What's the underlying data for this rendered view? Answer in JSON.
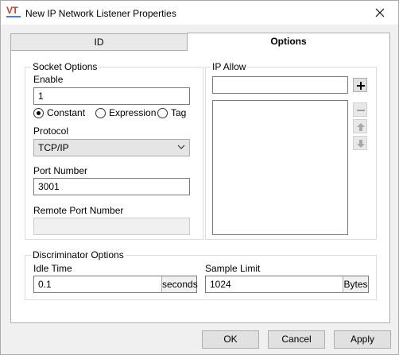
{
  "window": {
    "title": "New IP Network Listener Properties",
    "app_icon_text": "VT"
  },
  "tabs": [
    {
      "label": "ID"
    },
    {
      "label": "Options"
    }
  ],
  "socket_options": {
    "title": "Socket Options",
    "enable_label": "Enable",
    "enable_value": "1",
    "radios": [
      {
        "label": "Constant",
        "checked": true
      },
      {
        "label": "Expression",
        "checked": false
      },
      {
        "label": "Tag",
        "checked": false
      }
    ],
    "protocol_label": "Protocol",
    "protocol_value": "TCP/IP",
    "port_label": "Port Number",
    "port_value": "3001",
    "remote_port_label": "Remote Port Number",
    "remote_port_value": ""
  },
  "ip_allow": {
    "title": "IP Allow",
    "input_value": "",
    "add_icon": "plus-icon",
    "remove_icon": "minus-icon",
    "up_icon": "arrow-up-icon",
    "down_icon": "arrow-down-icon"
  },
  "discriminator_options": {
    "title": "Discriminator Options",
    "idle_label": "Idle Time",
    "idle_value": "0.1",
    "idle_unit": "seconds",
    "sample_label": "Sample Limit",
    "sample_value": "1024",
    "sample_unit": "Bytes"
  },
  "buttons": {
    "ok": "OK",
    "cancel": "Cancel",
    "apply": "Apply"
  }
}
